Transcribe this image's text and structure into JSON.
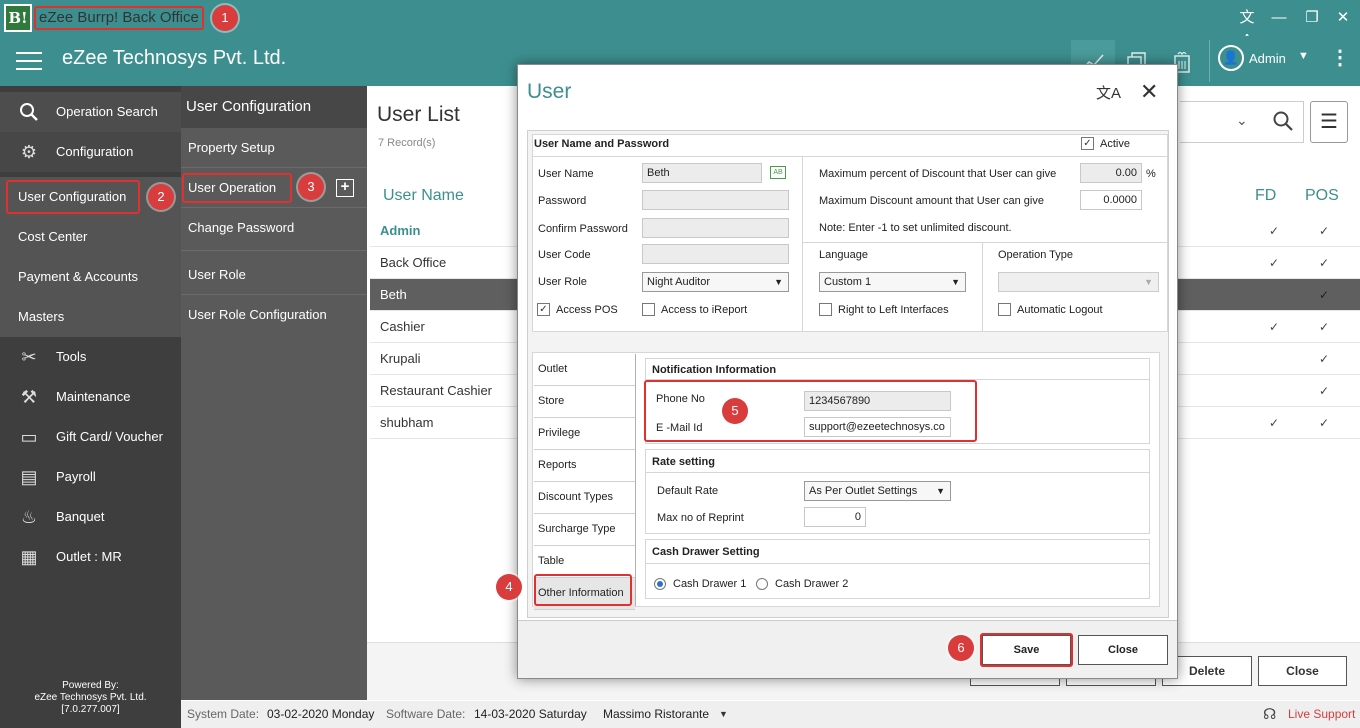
{
  "window": {
    "app_logo": "B!",
    "title": "eZee Burrp! Back Office",
    "translate_icon": "文A",
    "minimize": "—",
    "maximize": "❐",
    "close": "✕"
  },
  "header": {
    "company": "eZee Technosys Pvt. Ltd.",
    "user": "Admin"
  },
  "sidebar": {
    "items": [
      {
        "label": "Operation Search",
        "icon": "search-icon"
      },
      {
        "label": "Configuration",
        "icon": "gear-icon"
      },
      {
        "label": "User Configuration"
      },
      {
        "label": "Cost Center"
      },
      {
        "label": "Payment & Accounts"
      },
      {
        "label": "Masters"
      },
      {
        "label": "Tools",
        "icon": "tools-icon"
      },
      {
        "label": "Maintenance",
        "icon": "maintenance-icon"
      },
      {
        "label": "Gift Card/ Voucher",
        "icon": "gift-card-icon"
      },
      {
        "label": "Payroll",
        "icon": "payroll-icon"
      },
      {
        "label": "Banquet",
        "icon": "banquet-icon"
      },
      {
        "label": "Outlet : MR",
        "icon": "outlet-icon"
      }
    ],
    "powered_by": "Powered By:",
    "powered_company": "eZee Technosys Pvt. Ltd.",
    "version": "[7.0.277.007]"
  },
  "submenu": {
    "title": "User Configuration",
    "items": [
      "Property Setup",
      "User Operation",
      "Change Password",
      "User Role",
      "User Role Configuration"
    ],
    "add_icon": "+"
  },
  "content": {
    "title": "User List",
    "records": "7 Record(s)",
    "columns": {
      "name": "User Name",
      "fd": "FD",
      "pos": "POS"
    },
    "rows": [
      {
        "name": "Admin",
        "fd": "✓",
        "pos": "✓"
      },
      {
        "name": "Back Office",
        "fd": "✓",
        "pos": "✓"
      },
      {
        "name": "Beth",
        "fd": "",
        "pos": "✓"
      },
      {
        "name": "Cashier",
        "fd": "✓",
        "pos": "✓"
      },
      {
        "name": "Krupali",
        "fd": "",
        "pos": "✓"
      },
      {
        "name": "Restaurant Cashier",
        "fd": "",
        "pos": "✓"
      },
      {
        "name": "shubham",
        "fd": "✓",
        "pos": "✓"
      }
    ],
    "buttons": {
      "delete": "Delete",
      "close": "Close"
    }
  },
  "statusbar": {
    "system_date_label": "System Date:",
    "system_date": "03-02-2020 Monday",
    "software_date_label": "Software Date:",
    "software_date": "14-03-2020 Saturday",
    "property": "Massimo Ristorante",
    "live_support": "Live Support"
  },
  "dialog": {
    "title": "User",
    "section_title": "User Name and Password",
    "active_label": "Active",
    "active": true,
    "user_name_label": "User Name",
    "user_name": "Beth",
    "password_label": "Password",
    "confirm_password_label": "Confirm Password",
    "user_code_label": "User Code",
    "user_role_label": "User Role",
    "user_role": "Night Auditor",
    "access_pos_label": "Access POS",
    "access_pos": true,
    "access_ireport_label": "Access to iReport",
    "max_discount_percent_label": "Maximum percent of Discount that User can give",
    "max_discount_percent": "0.00",
    "percent_sign": "%",
    "max_discount_amount_label": "Maximum Discount amount that User can give",
    "max_discount_amount": "0.0000",
    "discount_note": "Note: Enter -1 to set unlimited discount.",
    "language_label": "Language",
    "language": "Custom 1",
    "rtl_label": "Right to Left Interfaces",
    "operation_type_label": "Operation Type",
    "operation_type": "",
    "auto_logout_label": "Automatic Logout",
    "tabs": [
      "Outlet",
      "Store",
      "Privilege",
      "Reports",
      "Discount Types",
      "Surcharge Type",
      "Table",
      "Other Information"
    ],
    "notification": {
      "title": "Notification Information",
      "phone_label": "Phone No",
      "phone": "1234567890",
      "email_label": "E -Mail Id",
      "email": "support@ezeetechnosys.co"
    },
    "rate": {
      "title": "Rate setting",
      "default_rate_label": "Default Rate",
      "default_rate": "As Per Outlet Settings",
      "max_reprint_label": "Max no of Reprint",
      "max_reprint": "0"
    },
    "cash_drawer": {
      "title": "Cash Drawer Setting",
      "option1": "Cash Drawer 1",
      "option2": "Cash Drawer 2",
      "selected": "Cash Drawer 1"
    },
    "save_label": "Save",
    "close_label": "Close"
  },
  "callouts": [
    "1",
    "2",
    "3",
    "4",
    "5",
    "6"
  ],
  "colors": {
    "header_teal": "#3d8f8f",
    "sidebar_dark": "#3e3e3e",
    "callout_red": "#d93c3c",
    "accent_text": "#3d8f8f"
  }
}
